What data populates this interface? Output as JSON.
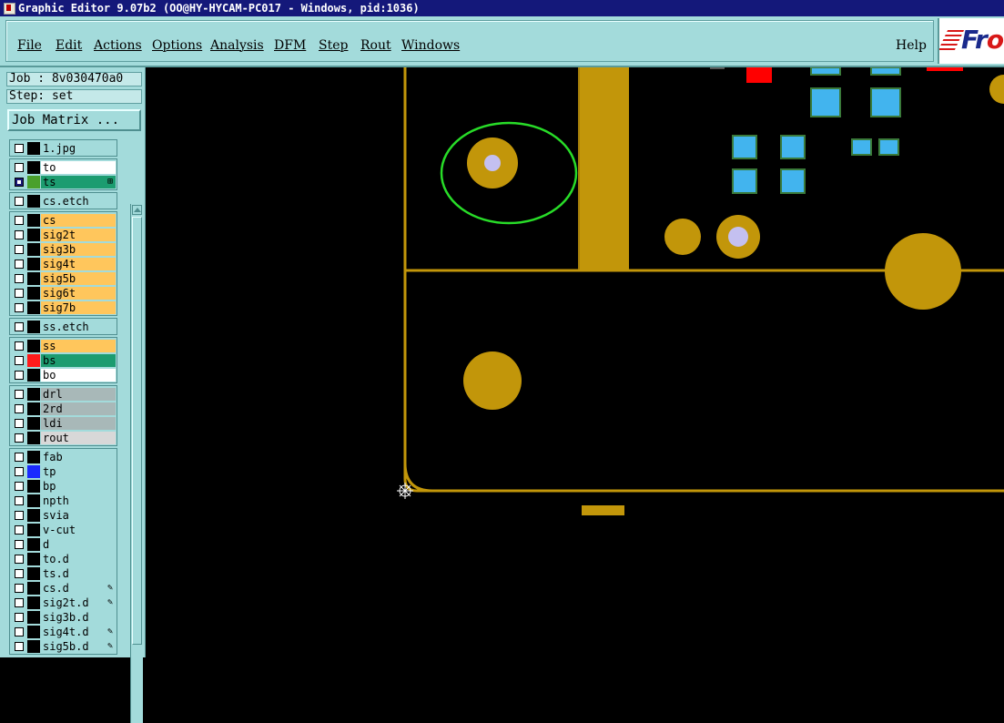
{
  "window": {
    "title": "Graphic Editor 9.07b2 (OO@HY-HYCAM-PC017 - Windows, pid:1036)"
  },
  "menubar": {
    "items": [
      "File",
      "Edit",
      "Actions",
      "Options",
      "Analysis",
      "DFM",
      "Step",
      "Rout",
      "Windows"
    ],
    "help": "Help",
    "logo_text": "Fr"
  },
  "panel": {
    "job": "Job : 8v030470a0",
    "step": "Step: set",
    "job_matrix": "Job Matrix ..."
  },
  "layer_groups": [
    {
      "layers": [
        {
          "name": "1.jpg",
          "bg": "#a3dbdb",
          "swatch": "#000000",
          "selected": false,
          "mark": ""
        }
      ]
    },
    {
      "layers": [
        {
          "name": "to",
          "bg": "#ffffff",
          "swatch": "#000000",
          "selected": false,
          "mark": ""
        },
        {
          "name": "ts",
          "bg": "#1c9c70",
          "swatch": "#4aa02c",
          "selected": true,
          "mark": "⊞"
        }
      ]
    },
    {
      "layers": [
        {
          "name": "cs.etch",
          "bg": "#a3dbdb",
          "swatch": "#000000",
          "selected": false,
          "mark": ""
        }
      ]
    },
    {
      "layers": [
        {
          "name": "cs",
          "bg": "#ffc65c",
          "swatch": "#000000",
          "selected": false,
          "mark": ""
        },
        {
          "name": "sig2t",
          "bg": "#ffc65c",
          "swatch": "#000000",
          "selected": false,
          "mark": ""
        },
        {
          "name": "sig3b",
          "bg": "#ffc65c",
          "swatch": "#000000",
          "selected": false,
          "mark": ""
        },
        {
          "name": "sig4t",
          "bg": "#ffc65c",
          "swatch": "#000000",
          "selected": false,
          "mark": ""
        },
        {
          "name": "sig5b",
          "bg": "#ffc65c",
          "swatch": "#000000",
          "selected": false,
          "mark": ""
        },
        {
          "name": "sig6t",
          "bg": "#ffc65c",
          "swatch": "#000000",
          "selected": false,
          "mark": ""
        },
        {
          "name": "sig7b",
          "bg": "#ffc65c",
          "swatch": "#000000",
          "selected": false,
          "mark": ""
        }
      ]
    },
    {
      "layers": [
        {
          "name": "ss.etch",
          "bg": "#a3dbdb",
          "swatch": "#000000",
          "selected": false,
          "mark": ""
        }
      ]
    },
    {
      "layers": [
        {
          "name": "ss",
          "bg": "#ffc65c",
          "swatch": "#000000",
          "selected": false,
          "mark": ""
        },
        {
          "name": "bs",
          "bg": "#1c9c70",
          "swatch": "#ff1a1a",
          "selected": false,
          "mark": ""
        },
        {
          "name": "bo",
          "bg": "#ffffff",
          "swatch": "#000000",
          "selected": false,
          "mark": ""
        }
      ]
    },
    {
      "layers": [
        {
          "name": "drl",
          "bg": "#a8b8b8",
          "swatch": "#000000",
          "selected": false,
          "mark": ""
        },
        {
          "name": "2rd",
          "bg": "#a8b8b8",
          "swatch": "#000000",
          "selected": false,
          "mark": ""
        },
        {
          "name": "ldi",
          "bg": "#a8b8b8",
          "swatch": "#000000",
          "selected": false,
          "mark": ""
        },
        {
          "name": "rout",
          "bg": "#d8d8d8",
          "swatch": "#000000",
          "selected": false,
          "mark": ""
        }
      ]
    },
    {
      "layers": [
        {
          "name": "fab",
          "bg": "#a3dbdb",
          "swatch": "#000000",
          "selected": false,
          "mark": ""
        },
        {
          "name": "tp",
          "bg": "#a3dbdb",
          "swatch": "#1a2aff",
          "selected": false,
          "mark": ""
        },
        {
          "name": "bp",
          "bg": "#a3dbdb",
          "swatch": "#000000",
          "selected": false,
          "mark": ""
        },
        {
          "name": "npth",
          "bg": "#a3dbdb",
          "swatch": "#000000",
          "selected": false,
          "mark": ""
        },
        {
          "name": "svia",
          "bg": "#a3dbdb",
          "swatch": "#000000",
          "selected": false,
          "mark": ""
        },
        {
          "name": "v-cut",
          "bg": "#a3dbdb",
          "swatch": "#000000",
          "selected": false,
          "mark": ""
        },
        {
          "name": "d",
          "bg": "#a3dbdb",
          "swatch": "#000000",
          "selected": false,
          "mark": ""
        },
        {
          "name": "to.d",
          "bg": "#a3dbdb",
          "swatch": "#000000",
          "selected": false,
          "mark": ""
        },
        {
          "name": "ts.d",
          "bg": "#a3dbdb",
          "swatch": "#000000",
          "selected": false,
          "mark": ""
        },
        {
          "name": "cs.d",
          "bg": "#a3dbdb",
          "swatch": "#000000",
          "selected": false,
          "mark": "✎"
        },
        {
          "name": "sig2t.d",
          "bg": "#a3dbdb",
          "swatch": "#000000",
          "selected": false,
          "mark": "✎"
        },
        {
          "name": "sig3b.d",
          "bg": "#a3dbdb",
          "swatch": "#000000",
          "selected": false,
          "mark": ""
        },
        {
          "name": "sig4t.d",
          "bg": "#a3dbdb",
          "swatch": "#000000",
          "selected": false,
          "mark": "✎"
        },
        {
          "name": "sig5b.d",
          "bg": "#a3dbdb",
          "swatch": "#000000",
          "selected": false,
          "mark": "✎"
        }
      ]
    }
  ],
  "colors": {
    "copper": "#c2960a",
    "pad_blue": "#42b4ee",
    "highlight_green": "#28dc28",
    "via_center": "#c4c0f0",
    "board_red": "#ff0000"
  }
}
